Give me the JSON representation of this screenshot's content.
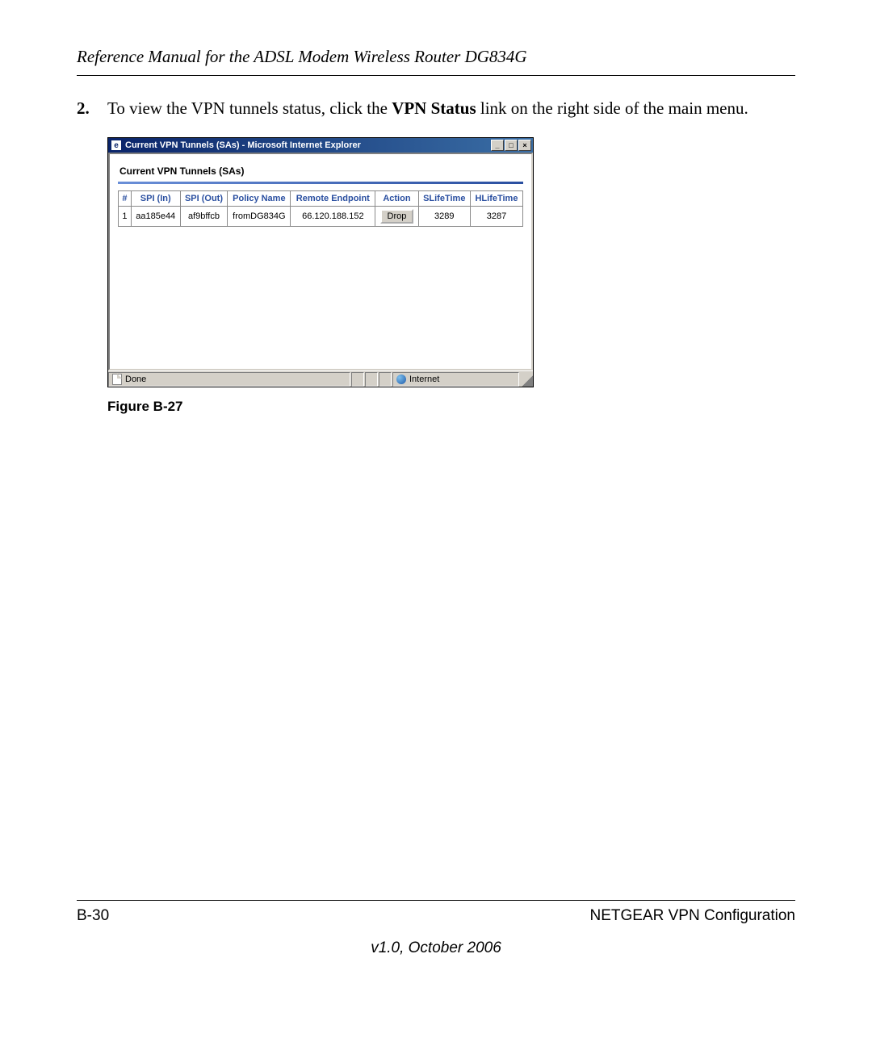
{
  "header_title": "Reference Manual for the ADSL Modem Wireless Router DG834G",
  "step": {
    "number": "2.",
    "text_before": "To view the VPN tunnels status, click the ",
    "bold": "VPN Status",
    "text_after": " link on the right side of the main menu."
  },
  "window": {
    "title": "Current VPN Tunnels (SAs) - Microsoft Internet Explorer",
    "panel_title": "Current VPN Tunnels (SAs)",
    "columns": [
      "#",
      "SPI (In)",
      "SPI (Out)",
      "Policy Name",
      "Remote Endpoint",
      "Action",
      "SLifeTime",
      "HLifeTime"
    ],
    "row": {
      "num": "1",
      "spi_in": "aa185e44",
      "spi_out": "af9bffcb",
      "policy": "fromDG834G",
      "endpoint": "66.120.188.152",
      "action": "Drop",
      "slife": "3289",
      "hlife": "3287"
    },
    "status_done": "Done",
    "status_zone": "Internet"
  },
  "figure_caption": "Figure B-27",
  "footer": {
    "page": "B-30",
    "section": "NETGEAR VPN Configuration",
    "version": "v1.0, October 2006"
  }
}
